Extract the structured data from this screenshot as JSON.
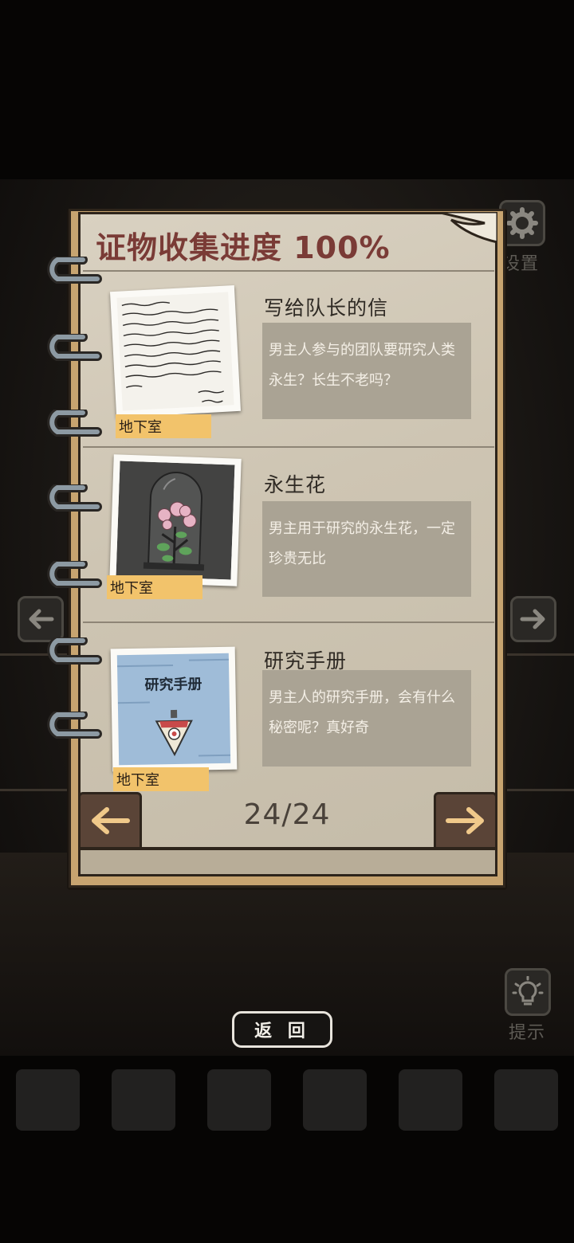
{
  "header": {
    "title": "证物收集进度 100%"
  },
  "items": [
    {
      "name": "写给队长的信",
      "description": "男主人参与的团队要研究人类永生？长生不老吗？",
      "location": "地下室",
      "thumb_icon": "letter-icon"
    },
    {
      "name": "永生花",
      "description": "男主用于研究的永生花，一定珍贵无比",
      "location": "地下室",
      "thumb_icon": "glass-dome-flower-icon"
    },
    {
      "name": "研究手册",
      "description": "男主人的研究手册，会有什么秘密呢？真好奇",
      "location": "地下室",
      "thumb_icon": "notebook-icon",
      "thumb_title": "研究手册"
    }
  ],
  "pagination": {
    "label": "24/24"
  },
  "side": {
    "settings_label": "设置",
    "hint_label": "提示"
  },
  "footer": {
    "back_label": "返 回"
  },
  "colors": {
    "title": "#7a3b36",
    "tag": "#f2c36b",
    "desc_box": "#aaa394",
    "nav_arrow": "#f0c98a"
  }
}
